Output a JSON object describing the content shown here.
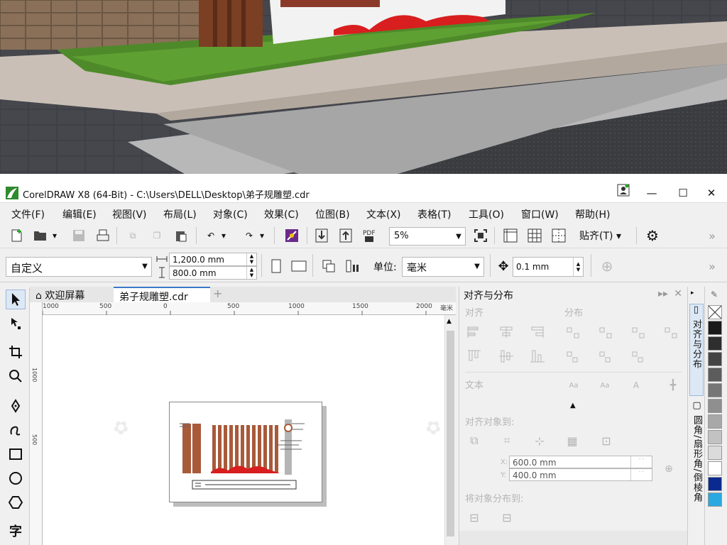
{
  "app": {
    "title": "CorelDRAW X8 (64-Bit) - C:\\Users\\DELL\\Desktop\\弟子规雕塑.cdr",
    "window_controls": {
      "minimize": "—",
      "maximize": "☐",
      "close": "✕"
    }
  },
  "menu": [
    "文件(F)",
    "编辑(E)",
    "视图(V)",
    "布局(L)",
    "对象(C)",
    "效果(C)",
    "位图(B)",
    "文本(X)",
    "表格(T)",
    "工具(O)",
    "窗口(W)",
    "帮助(H)"
  ],
  "toolbar": {
    "zoom_value": "5%",
    "snap_label": "贴齐(T)",
    "more": "»"
  },
  "propbar": {
    "page_preset": "自定义",
    "width": "1,200.0 mm",
    "height": "800.0 mm",
    "units_label": "单位:",
    "units_value": "毫米",
    "nudge": "0.1 mm",
    "more": "»"
  },
  "tabs": {
    "welcome": "欢迎屏幕",
    "document": "弟子规雕塑.cdr",
    "add": "+"
  },
  "ruler": {
    "h_ticks": [
      "1000",
      "500",
      "0",
      "500",
      "1000",
      "1500",
      "2000"
    ],
    "h_unit": "毫米",
    "v_ticks": [
      "1000",
      "500"
    ]
  },
  "docker": {
    "title": "对齐与分布",
    "sec_align": "对齐",
    "sec_distribute": "分布",
    "sec_text": "文本",
    "sec_align_to": "对齐对象到:",
    "x_label": "X:",
    "x_value": "600.0 mm",
    "y_label": "Y:",
    "y_value": "400.0 mm",
    "sec_distribute_to": "将对象分布到:"
  },
  "side_tabs": [
    "对齐与分布",
    "圆角/扇形角/倒棱角"
  ],
  "palette_colors": [
    "#ffffff",
    "#1a1a1a",
    "#2e2e2e",
    "#444444",
    "#5c5c5c",
    "#767676",
    "#8f8f8f",
    "#a8a8a8",
    "#c2c2c2",
    "#dbdbdb",
    "#ffffff",
    "#0b2a8f",
    "#2aa8e0"
  ],
  "photo": {
    "colors": {
      "road": "#3d3f44",
      "curb": "#c9bfb6",
      "grass": "#4e8a2a",
      "wood": "#7b3f23",
      "red": "#d81e1e"
    }
  }
}
